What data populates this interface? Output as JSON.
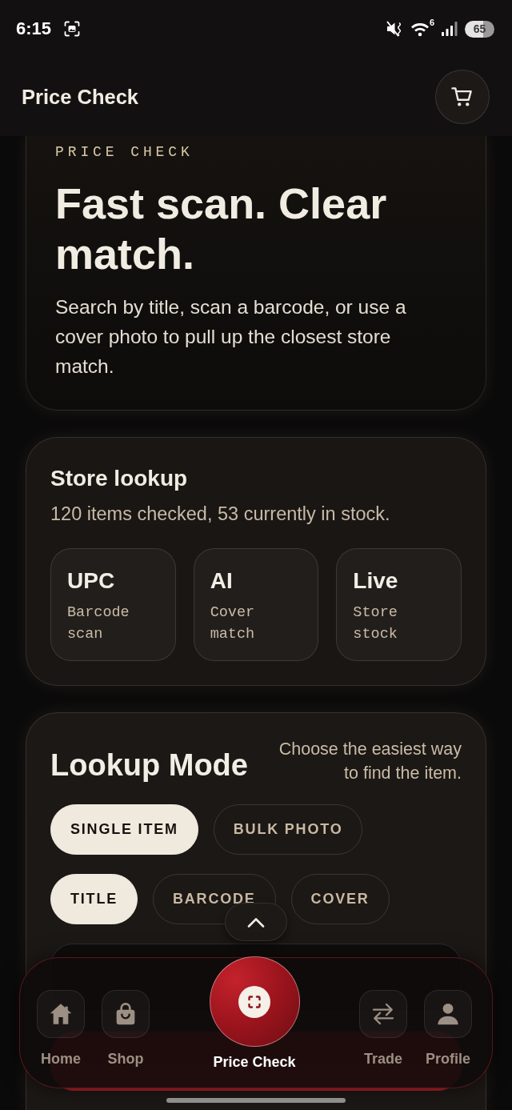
{
  "status_bar": {
    "time": "6:15",
    "wifi_badge": "6",
    "battery": "65"
  },
  "header": {
    "title": "Price Check"
  },
  "hero": {
    "eyebrow": "PRICE CHECK",
    "heading": "Fast scan. Clear match.",
    "body": "Search by title, scan a barcode, or use a cover photo to pull up the closest store match."
  },
  "store_lookup": {
    "title": "Store lookup",
    "summary": "120 items checked, 53 currently in stock.",
    "tiles": [
      {
        "label": "UPC",
        "caption": "Barcode scan"
      },
      {
        "label": "AI",
        "caption": "Cover match"
      },
      {
        "label": "Live",
        "caption": "Store stock"
      }
    ]
  },
  "lookup_mode": {
    "title": "Lookup Mode",
    "hint": "Choose the easiest way to find the item.",
    "modes": [
      {
        "label": "SINGLE ITEM",
        "selected": true
      },
      {
        "label": "BULK PHOTO",
        "selected": false
      }
    ],
    "sources": [
      {
        "label": "TITLE",
        "selected": true
      },
      {
        "label": "BARCODE",
        "selected": false
      },
      {
        "label": "COVER",
        "selected": false
      }
    ]
  },
  "bottom_nav": {
    "items": [
      {
        "label": "Home",
        "selected": false
      },
      {
        "label": "Shop",
        "selected": false
      },
      {
        "label": "Price Check",
        "selected": true
      },
      {
        "label": "Trade",
        "selected": false
      },
      {
        "label": "Profile",
        "selected": false
      }
    ]
  }
}
